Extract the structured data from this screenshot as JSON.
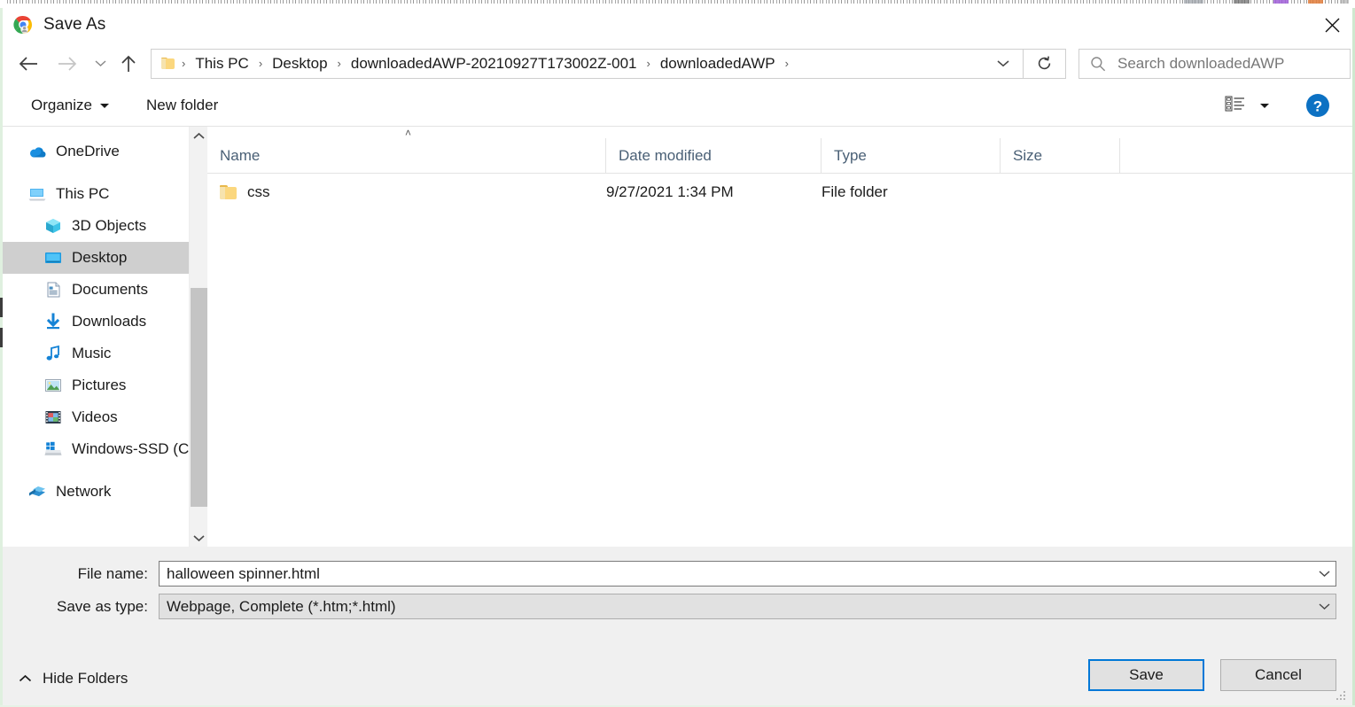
{
  "window": {
    "title": "Save As",
    "app_icon": "chrome-icon",
    "close_label": "Close"
  },
  "nav": {
    "back": "Back",
    "forward": "Forward",
    "recent": "Recent locations",
    "up": "Up one level"
  },
  "breadcrumb": {
    "folder_icon": "folder-icon",
    "separator": "›",
    "items": [
      {
        "label": "This PC"
      },
      {
        "label": "Desktop"
      },
      {
        "label": "downloadedAWP-20210927T173002Z-001"
      },
      {
        "label": "downloadedAWP"
      }
    ],
    "dropdown_label": "Previous locations",
    "refresh_label": "Refresh"
  },
  "search": {
    "icon": "search-icon",
    "placeholder": "Search downloadedAWP"
  },
  "toolbar": {
    "organize_label": "Organize",
    "new_folder_label": "New folder",
    "view_label": "Change your view",
    "help_label": "Help",
    "help_glyph": "?"
  },
  "sidebar": {
    "items": [
      {
        "label": "OneDrive",
        "icon": "onedrive-icon",
        "indent": false,
        "selected": false
      },
      {
        "label": "This PC",
        "icon": "this-pc-icon",
        "indent": false,
        "selected": false
      },
      {
        "label": "3D Objects",
        "icon": "3d-objects-icon",
        "indent": true,
        "selected": false
      },
      {
        "label": "Desktop",
        "icon": "desktop-icon",
        "indent": true,
        "selected": true
      },
      {
        "label": "Documents",
        "icon": "documents-icon",
        "indent": true,
        "selected": false
      },
      {
        "label": "Downloads",
        "icon": "downloads-icon",
        "indent": true,
        "selected": false
      },
      {
        "label": "Music",
        "icon": "music-icon",
        "indent": true,
        "selected": false
      },
      {
        "label": "Pictures",
        "icon": "pictures-icon",
        "indent": true,
        "selected": false
      },
      {
        "label": "Videos",
        "icon": "videos-icon",
        "indent": true,
        "selected": false
      },
      {
        "label": "Windows-SSD (C",
        "icon": "drive-icon",
        "indent": true,
        "selected": false
      },
      {
        "label": "Network",
        "icon": "network-icon",
        "indent": false,
        "selected": false
      }
    ],
    "scroll_up_label": "Scroll up",
    "scroll_down_label": "Scroll down"
  },
  "filelist": {
    "sort_indicator": "˄",
    "columns": [
      {
        "key": "name",
        "label": "Name"
      },
      {
        "key": "date",
        "label": "Date modified"
      },
      {
        "key": "type",
        "label": "Type"
      },
      {
        "key": "size",
        "label": "Size"
      }
    ],
    "rows": [
      {
        "name": "css",
        "date": "9/27/2021 1:34 PM",
        "type": "File folder",
        "size": "",
        "icon": "folder-icon"
      }
    ]
  },
  "form": {
    "filename_label": "File name:",
    "filename_value": "halloween spinner.html",
    "filetype_label": "Save as type:",
    "filetype_value": "Webpage, Complete (*.htm;*.html)",
    "dropdown_glyph": "˅"
  },
  "footer": {
    "hide_folders_label": "Hide Folders",
    "save_label": "Save",
    "cancel_label": "Cancel"
  },
  "colors": {
    "accent": "#0078d7",
    "selection": "#cfcfcf",
    "column_header_text": "#4a6076",
    "footer_bg": "#f0f0f0",
    "folder_yellow": "#fbd77e"
  }
}
